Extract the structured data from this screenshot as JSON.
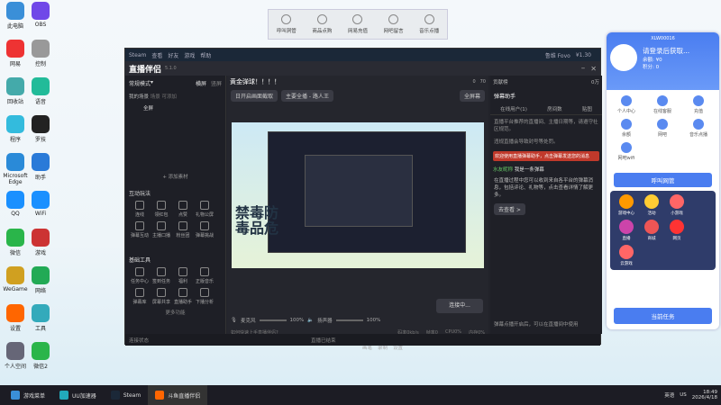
{
  "desktop": {
    "icons": [
      {
        "label": "此电脑",
        "color": "#3a8fd8"
      },
      {
        "label": "网易",
        "color": "#e33"
      },
      {
        "label": "回收站",
        "color": "#4aa"
      },
      {
        "label": "程序",
        "color": "#3bd"
      },
      {
        "label": "Microsoft Edge",
        "color": "#2a8ad8"
      },
      {
        "label": "QQ",
        "color": "#1a90ff"
      },
      {
        "label": "微信",
        "color": "#2ab54a"
      },
      {
        "label": "WeGame",
        "color": "#d0a020"
      },
      {
        "label": "设置",
        "color": "#f60"
      },
      {
        "label": "个人空间",
        "color": "#667"
      },
      {
        "label": "OBS",
        "color": "#7048e8"
      },
      {
        "label": "控制",
        "color": "#999"
      },
      {
        "label": "语音",
        "color": "#2b9"
      },
      {
        "label": "罗技",
        "color": "#222"
      },
      {
        "label": "助手",
        "color": "#2a7ad8"
      },
      {
        "label": "WiFi",
        "color": "#1a90ff"
      },
      {
        "label": "游戏",
        "color": "#c33"
      },
      {
        "label": "网络",
        "color": "#2a5"
      },
      {
        "label": "工具",
        "color": "#3ab"
      },
      {
        "label": "微信2",
        "color": "#2ab54a"
      }
    ]
  },
  "topbar": {
    "items": [
      "呼叫洞管",
      "商品点购",
      "网易充值",
      "网吧留言",
      "音乐点播"
    ]
  },
  "steam": {
    "menu": [
      "Steam",
      "查看",
      "好友",
      "游戏",
      "帮助"
    ],
    "user": "鲁维 Fovo",
    "balance": "¥1.30",
    "nav": [
      "商店",
      "库",
      "社区",
      "鲁维子OVO"
    ]
  },
  "app": {
    "title": "直播伴侣",
    "version": "5.1.0"
  },
  "left": {
    "mode": "常规模式",
    "tabs": [
      "横屏",
      "竖屏"
    ],
    "scenes_label": "我的场景",
    "scene_tabs": [
      "场景",
      "可添加"
    ],
    "scene": "全屏",
    "add_material": "+ 添加素材",
    "interact_title": "互动玩法",
    "interact_tools": [
      "连线",
      "领红包",
      "点赞",
      "礼物公屏",
      "弹幕互动",
      "主播口播",
      "粉丝团",
      "弹幕挑战"
    ],
    "basic_title": "基础工具",
    "basic_tools": [
      "任务中心",
      "签到任务",
      "福利",
      "正版音乐",
      "弹幕库",
      "屏幕共享",
      "直播助手",
      "下播分析"
    ],
    "more": "更多功能"
  },
  "center": {
    "stream_title": "黄金弹球！！！！",
    "preview_btn": "日开启画面截取",
    "scene_btns": [
      "主要全播 - 路人王"
    ],
    "full_btn": "全屏幕",
    "stats": [
      "0",
      "70"
    ],
    "mic": "麦克风",
    "speaker": "扬声器",
    "vol1": "100%",
    "vol2": "100%",
    "tools": [
      "画笔",
      "录制",
      "设置"
    ],
    "go_live": "连接中...",
    "hint": "如何快速上手直播伴侣?",
    "meters": [
      "码率0kb/s",
      "帧率0",
      "CPU0%",
      "内存0%"
    ],
    "overlay": [
      "禁毒防",
      "毒品危"
    ]
  },
  "right": {
    "title": "贡献榜",
    "coins": "0万",
    "tabs": [
      "弹幕助手",
      "在线用户(1)",
      "房间数",
      "贴图"
    ],
    "notice1": "直播平台推荐的直播间、主播日期等，请遵守社区规范。",
    "notice2": "违规直播会导致封号等处罚。",
    "alert": "欢迎使用直播弹幕助手，点击弹幕发送您的消息",
    "user_msg_name": "水友昵称",
    "user_msg": "我是一条弹幕",
    "long_msg": "在直播过程中您可以收到来自各平台的弹幕消息，包括评论、礼物等，点击查看详情了解更多。",
    "view_btn": "去查看 >",
    "footer": "弹幕点播开启后，可以在直播间中使用"
  },
  "status": {
    "left": "连接状态",
    "center": "直播已结束"
  },
  "panel": {
    "user_id": "XLW00016",
    "login": "请登录后获取...",
    "balance": "余额: ¥0",
    "points": "积分: 0",
    "icons": [
      "个人中心",
      "在线客服",
      "充值",
      "余额",
      "网吧",
      "音乐点播",
      "网吧wifi"
    ],
    "call": "呼叫网管",
    "games": [
      "游戏中心",
      "活动",
      "小游戏",
      "直播",
      "商城",
      "网页",
      "云游戏"
    ],
    "task": "当前任务"
  },
  "taskbar": {
    "items": [
      "游戏菜单",
      "UU加速器",
      "Steam",
      "斗鱼直播伴侣"
    ],
    "time": "18:49",
    "date": "2026/4/18",
    "ime": "英语",
    "region": "US"
  }
}
